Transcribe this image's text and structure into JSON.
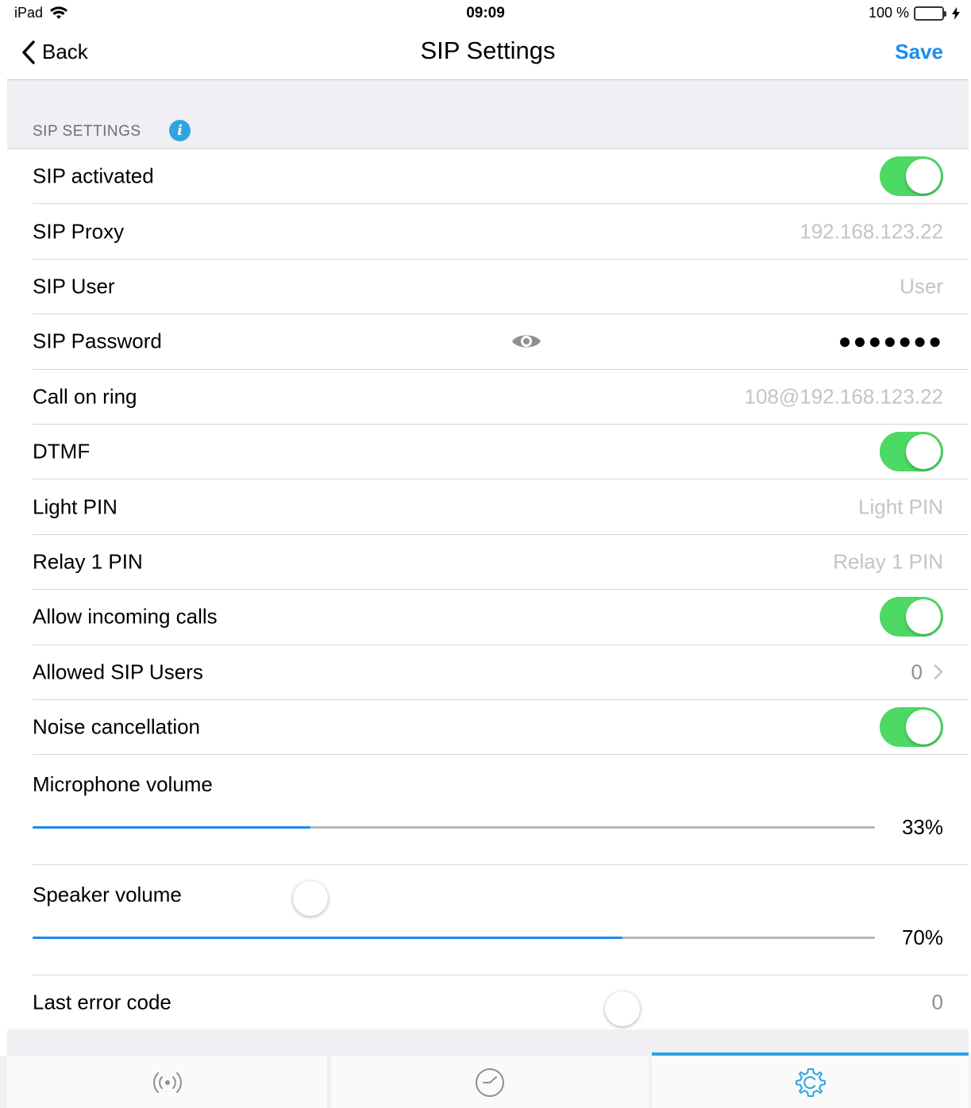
{
  "statusbar": {
    "device": "iPad",
    "time": "09:09",
    "battery_text": "100 %"
  },
  "navbar": {
    "back_label": "Back",
    "title": "SIP Settings",
    "save_label": "Save"
  },
  "section": {
    "title": "SIP SETTINGS"
  },
  "rows": {
    "sip_activated": {
      "label": "SIP activated",
      "on": true
    },
    "sip_proxy": {
      "label": "SIP Proxy",
      "value": "192.168.123.22"
    },
    "sip_user": {
      "label": "SIP User",
      "value": "User"
    },
    "sip_password": {
      "label": "SIP Password",
      "value": "●●●●●●●"
    },
    "call_on_ring": {
      "label": "Call on ring",
      "value": "108@192.168.123.22"
    },
    "dtmf": {
      "label": "DTMF",
      "on": true
    },
    "light_pin": {
      "label": "Light PIN",
      "value": "Light PIN"
    },
    "relay1_pin": {
      "label": "Relay 1 PIN",
      "value": "Relay 1 PIN"
    },
    "allow_incoming": {
      "label": "Allow incoming calls",
      "on": true
    },
    "allowed_users": {
      "label": "Allowed SIP Users",
      "value": "0"
    },
    "noise_cancel": {
      "label": "Noise cancellation",
      "on": true
    },
    "mic_volume": {
      "label": "Microphone volume",
      "value_text": "33%",
      "value": 0.33
    },
    "speaker_volume": {
      "label": "Speaker volume",
      "value_text": "70%",
      "value": 0.7
    },
    "last_error": {
      "label": "Last error code",
      "value": "0"
    }
  },
  "tabs": [
    {
      "icon": "broadcast-icon",
      "active": false
    },
    {
      "icon": "clock-icon",
      "active": false
    },
    {
      "icon": "gear-icon",
      "active": true
    }
  ],
  "colors": {
    "accent": "#1a8cf0",
    "toggle_on": "#4cd964",
    "info": "#2fa4e0"
  }
}
